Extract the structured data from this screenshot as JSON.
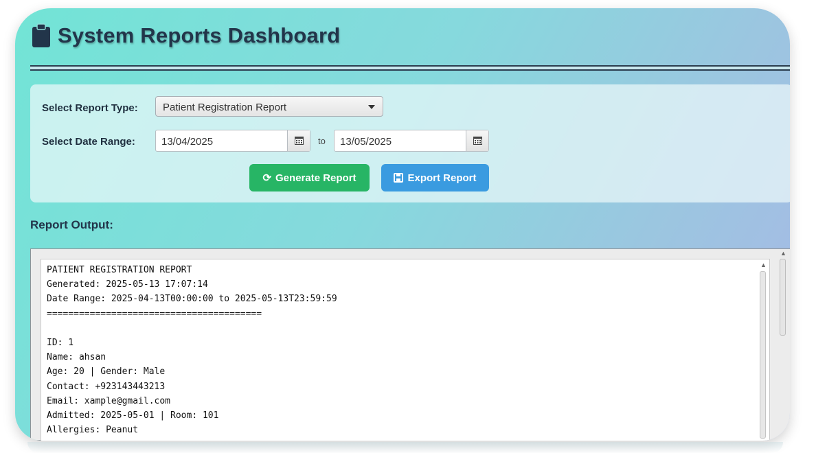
{
  "header": {
    "title": "System Reports Dashboard",
    "icon": "clipboard-icon"
  },
  "form": {
    "report_type_label": "Select Report Type:",
    "report_type_value": "Patient Registration Report",
    "date_range_label": "Select Date Range:",
    "start_date": "13/04/2025",
    "to_label": "to",
    "end_date": "13/05/2025",
    "generate_button_label": "Generate Report",
    "export_button_label": "Export Report"
  },
  "output": {
    "label": "Report Output:",
    "lines": [
      "PATIENT REGISTRATION REPORT",
      "Generated: 2025-05-13 17:07:14",
      "Date Range: 2025-04-13T00:00:00 to 2025-05-13T23:59:59",
      "========================================",
      "",
      "ID: 1",
      "Name: ahsan",
      "Age: 20 | Gender: Male",
      "Contact: +923143443213",
      "Email: xample@gmail.com",
      "Admitted: 2025-05-01 | Room: 101",
      "Allergies: Peanut"
    ]
  },
  "colors": {
    "generate_button": "#27b565",
    "export_button": "#3a9be0",
    "title_text": "#22354a"
  }
}
